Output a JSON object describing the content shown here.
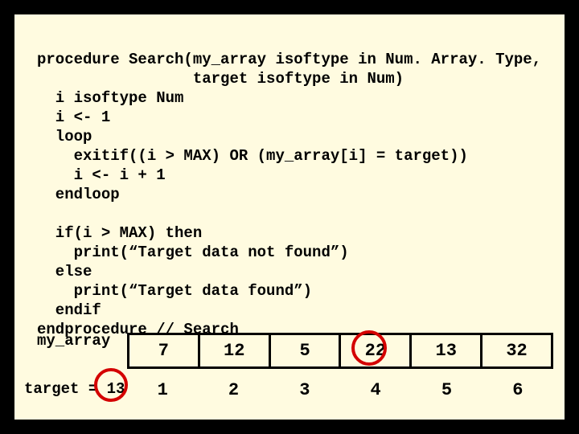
{
  "code": {
    "l1": "procedure Search(my_array isoftype in Num. Array. Type,",
    "l2": "                 target isoftype in Num)",
    "l3": "  i isoftype Num",
    "l4": "  i <- 1",
    "l5": "  loop",
    "l6": "    exitif((i > MAX) OR (my_array[i] = target))",
    "l7": "    i <- i + 1",
    "l8": "  endloop",
    "l9": "",
    "l10": "  if(i > MAX) then",
    "l11": "    print(“Target data not found”)",
    "l12": "  else",
    "l13": "    print(“Target data found”)",
    "l14": "  endif",
    "l15": "endprocedure // Search"
  },
  "labels": {
    "my_array": "my_array",
    "target": "target = 13"
  },
  "array": {
    "v1": "7",
    "v2": "12",
    "v3": "5",
    "v4": "22",
    "v5": "13",
    "v6": "32"
  },
  "idx": {
    "i1": "1",
    "i2": "2",
    "i3": "3",
    "i4": "4",
    "i5": "5",
    "i6": "6"
  },
  "highlighted": {
    "target_value": "13",
    "array_value": "22"
  }
}
